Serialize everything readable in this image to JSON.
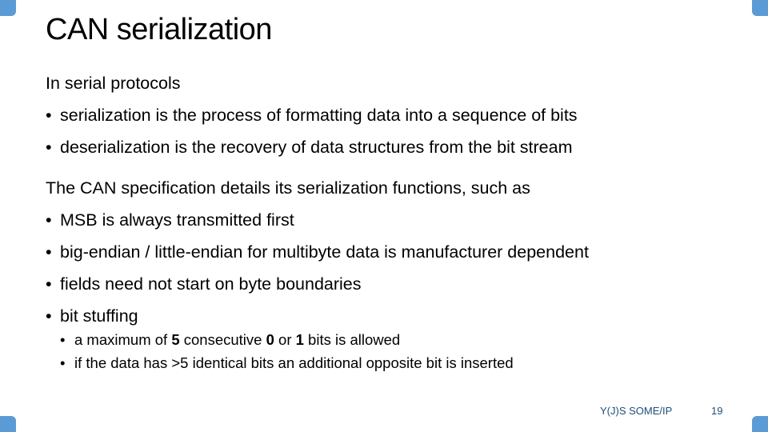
{
  "slide": {
    "title": "CAN serialization",
    "section1": {
      "heading": "In serial protocols",
      "bullets": [
        "serialization is the process of formatting data into a sequence of bits",
        "deserialization is the recovery of data structures from the bit stream"
      ]
    },
    "section2": {
      "heading": "The CAN specification details its serialization functions, such as",
      "bullets": [
        "MSB is always transmitted first",
        "big-endian / little-endian for multibyte data is manufacturer dependent",
        "fields need not start on byte boundaries",
        "bit stuffing"
      ],
      "sub_bullets": [
        {
          "pre": "a maximum of ",
          "b1": "5",
          "mid1": " consecutive ",
          "b2": "0",
          "mid2": " or ",
          "b3": "1",
          "post": " bits is allowed"
        },
        {
          "text": "if the data has >5 identical bits an additional opposite bit is inserted"
        }
      ]
    },
    "bullet_glyph": "•",
    "footer": {
      "label": "Y(J)S SOME/IP",
      "page_number": "19"
    },
    "accent_color": "#5b9bd5"
  }
}
